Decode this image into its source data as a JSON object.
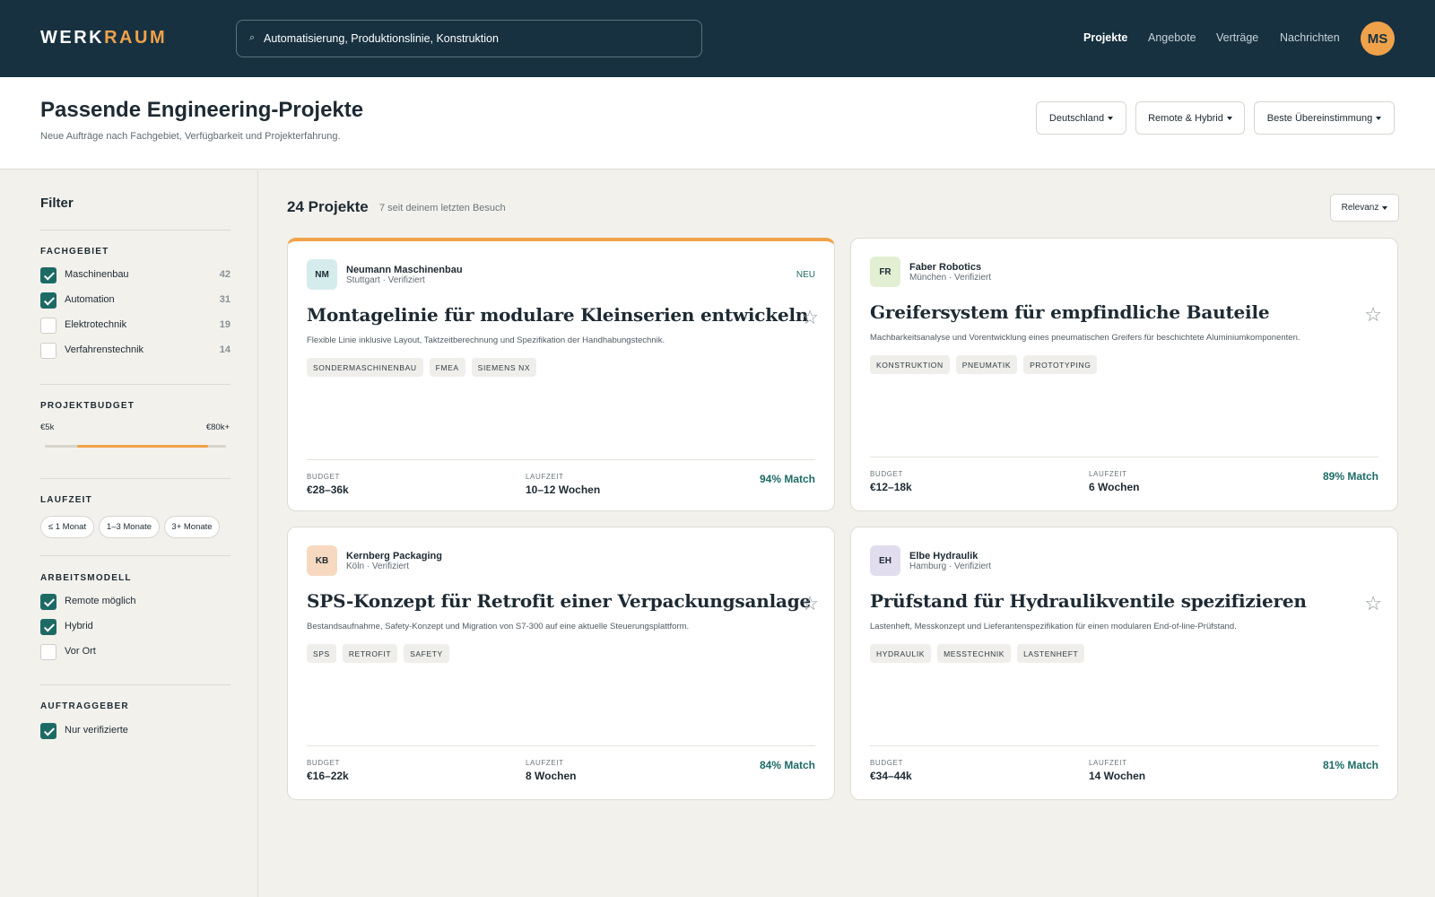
{
  "app": {
    "logo_main": "WERK",
    "logo_accent": "RAUM",
    "search_value": "Automatisierung, Produktionslinie, Konstruktion",
    "nav": [
      "Projekte",
      "Angebote",
      "Verträge",
      "Nachrichten"
    ],
    "active_nav": "Projekte",
    "avatar_initials": "MS",
    "accent_color": "#f0a24a",
    "primary_color": "#173140",
    "success_color": "#1d6a65"
  },
  "header": {
    "title": "Passende Engineering-Projekte",
    "subtitle": "Neue Aufträge nach Fachgebiet, Verfügbarkeit und Projekterfahrung.",
    "dropdowns": [
      "Deutschland",
      "Remote & Hybrid",
      "Beste Übereinstimmung"
    ]
  },
  "filters": {
    "title": "Filter",
    "fachgebiet": {
      "title": "FACHGEBIET",
      "items": [
        {
          "label": "Maschinenbau",
          "count": "42",
          "checked": true
        },
        {
          "label": "Automation",
          "count": "31",
          "checked": true
        },
        {
          "label": "Elektrotechnik",
          "count": "19",
          "checked": false
        },
        {
          "label": "Verfahrenstechnik",
          "count": "14",
          "checked": false
        }
      ]
    },
    "budget": {
      "title": "PROJEKTBUDGET",
      "min_label": "€5k",
      "max_label": "€80k+",
      "selected_fraction": [
        0.18,
        0.9
      ]
    },
    "laufzeit": {
      "title": "LAUFZEIT",
      "chips": [
        "≤ 1 Monat",
        "1–3 Monate",
        "3+ Monate"
      ]
    },
    "arbeitsmodell": {
      "title": "ARBEITSMODELL",
      "items": [
        {
          "label": "Remote möglich",
          "checked": true
        },
        {
          "label": "Hybrid",
          "checked": true
        },
        {
          "label": "Vor Ort",
          "checked": false
        }
      ]
    },
    "auftraggeber": {
      "title": "AUFTRAGGEBER",
      "items": [
        {
          "label": "Nur verifizierte",
          "checked": true
        }
      ]
    }
  },
  "results": {
    "count_title": "24 Projekte",
    "count_sub": "7 seit deinem letzten Besuch",
    "sort_label": "Relevanz",
    "budget_label": "BUDGET",
    "duration_label": "LAUFZEIT",
    "cards": [
      {
        "monogram": "NM",
        "monogram_color": "#d5ecec",
        "company": "Neumann Maschinenbau",
        "meta": "Stuttgart · Verifiziert",
        "badge": "NEU",
        "title": "Montagelinie für modulare Kleinserien entwickeln",
        "desc": "Flexible Linie inklusive Layout, Taktzeitberechnung und Spezifikation der Handhabungstechnik.",
        "tags": [
          "SONDERMASCHINENBAU",
          "FMEA",
          "SIEMENS NX"
        ],
        "budget": "€28–36k",
        "duration": "10–12 Wochen",
        "match": "94% Match"
      },
      {
        "monogram": "FR",
        "monogram_color": "#e2efd3",
        "company": "Faber Robotics",
        "meta": "München · Verifiziert",
        "badge": "",
        "title": "Greifersystem für empfindliche Bauteile",
        "desc": "Machbarkeitsanalyse und Vorentwicklung eines pneumatischen Greifers für beschichtete Aluminiumkomponenten.",
        "tags": [
          "KONSTRUKTION",
          "PNEUMATIK",
          "PROTOTYPING"
        ],
        "budget": "€12–18k",
        "duration": "6 Wochen",
        "match": "89% Match"
      },
      {
        "monogram": "KB",
        "monogram_color": "#f6d9c0",
        "company": "Kernberg Packaging",
        "meta": "Köln · Verifiziert",
        "badge": "",
        "title": "SPS-Konzept für Retrofit einer Verpackungsanlage",
        "desc": "Bestandsaufnahme, Safety-Konzept und Migration von S7-300 auf eine aktuelle Steuerungsplattform.",
        "tags": [
          "SPS",
          "RETROFIT",
          "SAFETY"
        ],
        "budget": "€16–22k",
        "duration": "8 Wochen",
        "match": "84% Match"
      },
      {
        "monogram": "EH",
        "monogram_color": "#e1ddef",
        "company": "Elbe Hydraulik",
        "meta": "Hamburg · Verifiziert",
        "badge": "",
        "title": "Prüfstand für Hydraulikventile spezifizieren",
        "desc": "Lastenheft, Messkonzept und Lieferantenspezifikation für einen modularen End-of-line-Prüfstand.",
        "tags": [
          "HYDRAULIK",
          "MESSTECHNIK",
          "LASTENHEFT"
        ],
        "budget": "€34–44k",
        "duration": "14 Wochen",
        "match": "81% Match"
      }
    ]
  }
}
